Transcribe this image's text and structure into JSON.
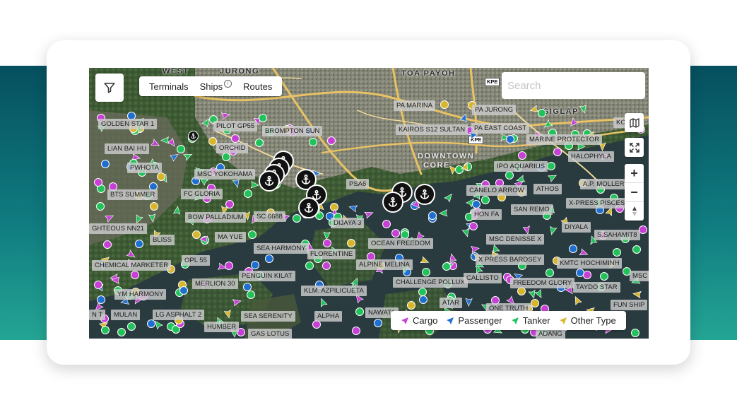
{
  "tabs": [
    "Terminals",
    "Ships",
    "Routes"
  ],
  "search_placeholder": "Search",
  "legend": [
    {
      "label": "Cargo",
      "color": "#c83fd6"
    },
    {
      "label": "Passenger",
      "color": "#1f6fd1"
    },
    {
      "label": "Tanker",
      "color": "#22c25a"
    },
    {
      "label": "Other Type",
      "color": "#d8b52a"
    }
  ],
  "places": [
    "WEST",
    "JURONG",
    "TOA PAYOH",
    "SIGLAP",
    "DOWNTOWN",
    "CORE"
  ],
  "road_badges": [
    "KPE",
    "KPE"
  ],
  "ship_labels": [
    "GOLDEN STAR 1",
    "PILOT GP55",
    "BROMPTON SUN",
    "LIAN BAI HU",
    "ORCHID",
    "PWHOTA",
    "MSC YOKOHAMA",
    "BTS SUMMER",
    "FC GLORIA",
    "BOW PALLADIUM",
    "SC 6688",
    "GHTEOUS NN21",
    "BLISS",
    "MA YUE",
    "SEA HARMONY",
    "CHEMICAL MARKETER",
    "OPL 55",
    "MERLION 30",
    "PENGUIN KILAT",
    "YM HARMONY",
    "N T",
    "MULAN",
    "LG ASPHALT 2",
    "HUMBER",
    "SEA SERENITY",
    "GAS LOTUS",
    "PA MARINA",
    "PA JURONG",
    "KAIROS S12 SULTAN",
    "PA EAST COAST",
    "PSA6",
    "DIJAYA 3",
    "OCEAN FREEDOM",
    "FLORENTINE",
    "ALPINE MELINA",
    "KLM. AZPILICUETA",
    "CHALLENGE POLLUX",
    "ALPHA",
    "NAWATA",
    "ATAR",
    "ONE TRUTH",
    "IPO AQUARIUS",
    "CANELO ARROW",
    "ATHOS",
    "SAN REMO",
    "HON FA",
    "MSC DENISSE X",
    "X PRESS BARDSEY",
    "CALLISTO",
    "FREEDOM GLORY",
    "MARINE PROTECTOR",
    "HALOPHYLA",
    "A.P. MOLLER",
    "X-PRESS PISCES",
    "DIYALA",
    "S.SAHAMIT8",
    "KMTC HOCHIMINH",
    "TAYDO STAR",
    "MSC",
    "FUN SHIP",
    "ADANG",
    "KO"
  ]
}
